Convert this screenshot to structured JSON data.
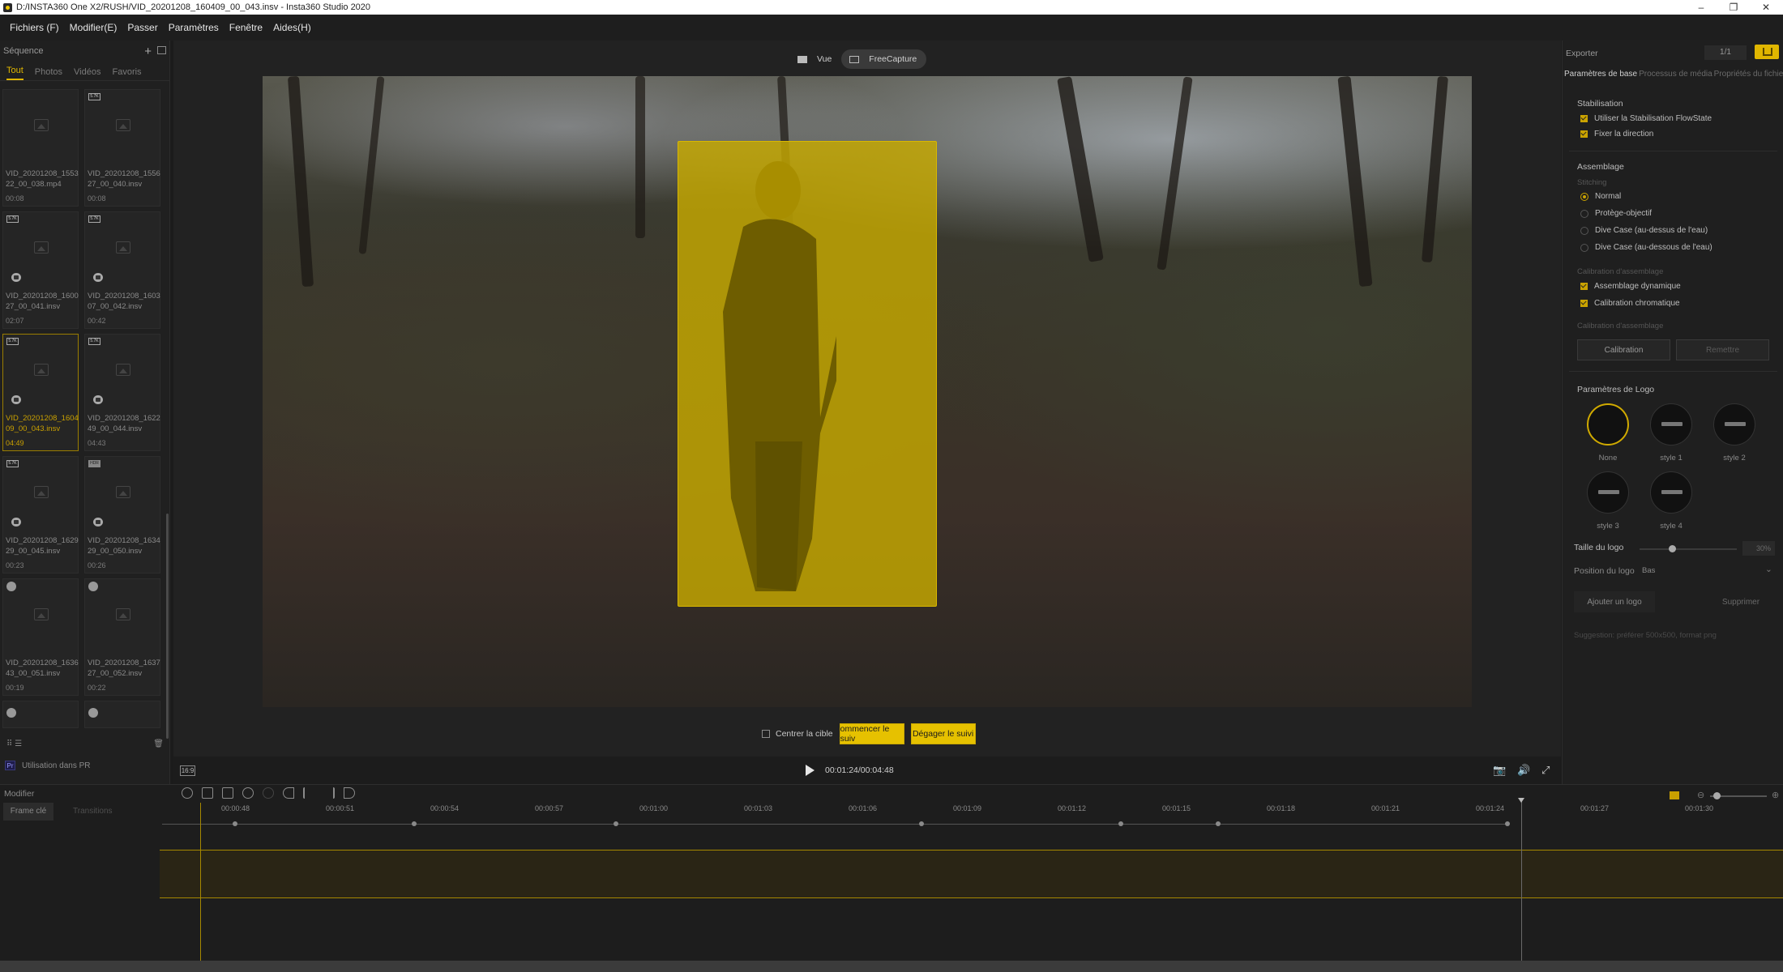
{
  "window": {
    "title": "D:/INSTA360 One X2/RUSH/VID_20201208_160409_00_043.insv - Insta360 Studio 2020",
    "minimize": "–",
    "maximize": "❐",
    "close": "✕"
  },
  "menu": [
    "Fichiers (F)",
    "Modifier(E)",
    "Passer",
    "Paramètres",
    "Fenêtre",
    "Aides(H)"
  ],
  "sequence": {
    "title": "Séquence",
    "add": "+",
    "tabs": [
      "Tout",
      "Photos",
      "Vidéos",
      "Favoris"
    ],
    "items": [
      {
        "name": "VID_20201208_155322_00_038.mp4",
        "duration": "00:08",
        "badge": ""
      },
      {
        "name": "VID_20201208_155627_00_040.insv",
        "duration": "00:08",
        "badge": "5.7K"
      },
      {
        "name": "VID_20201208_160027_00_041.insv",
        "duration": "02:07",
        "badge": "5.7K"
      },
      {
        "name": "VID_20201208_160307_00_042.insv",
        "duration": "00:42",
        "badge": "5.7K"
      },
      {
        "name": "VID_20201208_160409_00_043.insv",
        "duration": "04:49",
        "badge": "5.7K"
      },
      {
        "name": "VID_20201208_162249_00_044.insv",
        "duration": "04:43",
        "badge": "5.7K"
      },
      {
        "name": "VID_20201208_162929_00_045.insv",
        "duration": "00:23",
        "badge": "5.7K"
      },
      {
        "name": "VID_20201208_163429_00_050.insv",
        "duration": "00:26",
        "badge": "HDR"
      },
      {
        "name": "VID_20201208_163643_00_051.insv",
        "duration": "00:19",
        "badge": "●"
      },
      {
        "name": "VID_20201208_163727_00_052.insv",
        "duration": "00:22",
        "badge": "●"
      }
    ],
    "footer_left": "⠿ ☰",
    "footer_right": "🗑",
    "pr_label": "Utilisation dans PR",
    "pr_icon": "Pr"
  },
  "viewer": {
    "view_label": "Vue",
    "freecapture_label": "FreeCapture",
    "center_target": "Centrer la cible",
    "start_tracking": "ommencer le suiv",
    "stop_tracking": "Dégager le suivi",
    "ratio": "16:9",
    "time": "00:01:24/00:04:48",
    "camera_icon": "📷",
    "volume_icon": "🔊",
    "fullscreen_icon": "⤢"
  },
  "export": {
    "title": "Exporter",
    "page": "1/1",
    "tabs": [
      "Paramètres de base",
      "Processus de média",
      "Propriétés du fichier"
    ],
    "stabilisation_title": "Stabilisation",
    "stab_opts": [
      "Utiliser la Stabilisation FlowState",
      "Fixer la direction"
    ],
    "assemblage_title": "Assemblage",
    "stitching_label": "Stitching",
    "stitch_opts": [
      "Normal",
      "Protège-objectif",
      "Dive Case (au-dessus de l'eau)",
      "Dive Case (au-dessous de l'eau)"
    ],
    "calib_label": "Calibration d'assemblage",
    "calib_opts": [
      "Assemblage dynamique",
      "Calibration chromatique"
    ],
    "calib_label2": "Calibration d'assemblage",
    "calibration_btn": "Calibration",
    "reset_btn": "Remettre",
    "logo_title": "Paramètres de Logo",
    "logos": [
      "None",
      "style 1",
      "style 2",
      "style 3",
      "style 4"
    ],
    "logo_size_label": "Taille du logo",
    "logo_size_value": "30%",
    "logo_size": 0.3,
    "logo_pos_label": "Position du logo",
    "logo_pos_value": "Bas",
    "add_logo": "Ajouter un logo",
    "delete_logo": "Supprimer",
    "suggestion": "Suggestion: préférer 500x500, format png"
  },
  "timeline": {
    "modify": "Modifier",
    "keyframe_tab": "Frame clé",
    "transitions_tab": "Transitions",
    "ticks": [
      "00:00:48",
      "00:00:51",
      "00:00:54",
      "00:00:57",
      "00:01:00",
      "00:01:03",
      "00:01:06",
      "00:01:09",
      "00:01:12",
      "00:01:15",
      "00:01:18",
      "00:01:21",
      "00:01:24",
      "00:01:27",
      "00:01:30"
    ]
  }
}
